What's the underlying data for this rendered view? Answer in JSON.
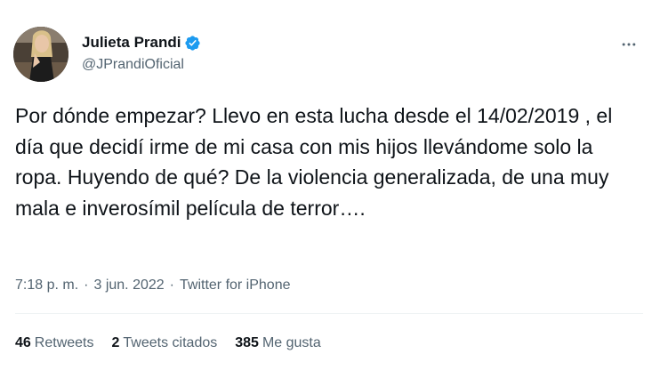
{
  "author": {
    "display_name": "Julieta Prandi",
    "handle": "@JPrandiOficial",
    "verified": true
  },
  "tweet": {
    "text": "Por dónde empezar? Llevo en esta lucha desde el 14/02/2019 , el día que decidí irme de mi casa con mis hijos llevándome solo la ropa. Huyendo de qué? De la violencia generalizada, de una muy mala e inverosímil película de terror….",
    "time": "7:18 p. m.",
    "date": "3 jun. 2022",
    "source": "Twitter for iPhone",
    "separator": "·"
  },
  "stats": {
    "retweets_count": "46",
    "retweets_label": "Retweets",
    "quotes_count": "2",
    "quotes_label": "Tweets citados",
    "likes_count": "385",
    "likes_label": "Me gusta"
  },
  "colors": {
    "verified_badge": "#1d9bf0",
    "secondary_text": "#536471",
    "primary_text": "#0f1419"
  },
  "icons": {
    "more": "more-horizontal-icon",
    "verified": "verified-badge-icon"
  }
}
